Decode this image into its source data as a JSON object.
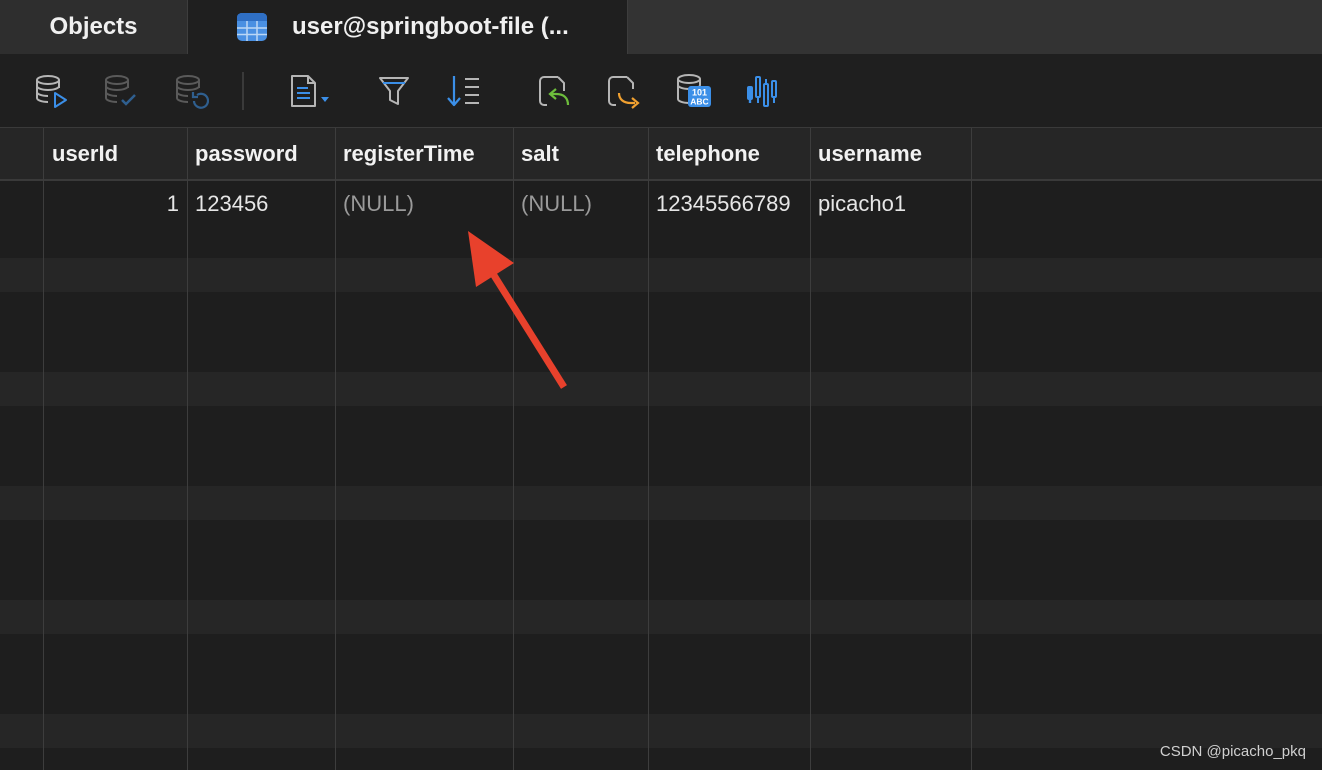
{
  "tabs": {
    "objects_label": "Objects",
    "table_tab_label": "user@springboot-file (..."
  },
  "toolbar": {
    "buttons": [
      {
        "icon": "db-begin-transaction-icon"
      },
      {
        "icon": "db-commit-icon"
      },
      {
        "icon": "db-rollback-icon"
      },
      {
        "icon": "text-view-dropdown-icon"
      },
      {
        "icon": "filter-icon"
      },
      {
        "icon": "sort-icon"
      },
      {
        "icon": "import-icon"
      },
      {
        "icon": "export-icon"
      },
      {
        "icon": "data-type-101-abc-icon"
      },
      {
        "icon": "chart-icon"
      }
    ]
  },
  "grid": {
    "columns": [
      "userId",
      "password",
      "registerTime",
      "salt",
      "telephone",
      "username"
    ],
    "rows": [
      [
        "1",
        "123456",
        "(NULL)",
        "(NULL)",
        "12345566789",
        "picacho1"
      ]
    ]
  },
  "annotation": {
    "arrow_color": "#e8412c"
  },
  "watermark": "CSDN @picacho_pkq",
  "colors": {
    "background": "#1e1e1e",
    "accent_blue": "#3b8fe8",
    "null_text": "#9a9a9a"
  }
}
